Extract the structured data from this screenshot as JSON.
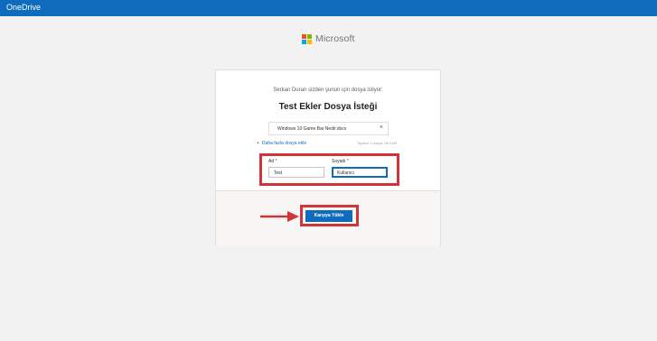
{
  "topbar": {
    "app_name": "OneDrive"
  },
  "brand": {
    "name": "Microsoft",
    "colors": [
      "#f25022",
      "#7fba00",
      "#00a4ef",
      "#ffb900"
    ]
  },
  "request": {
    "subtitle": "Serkan Duran sizden şunun için dosya istiyor:",
    "title": "Test Ekler Dosya İsteği"
  },
  "file": {
    "name": "Windows 10 Game Bar Nedir.docx",
    "remove_icon": "×"
  },
  "add_more": {
    "label": "Daha fazla dosya ekle",
    "icon": "+"
  },
  "total": {
    "text": "Toplam 1 dosya: 38,3 kB"
  },
  "form": {
    "first_name_label": "Ad",
    "first_name_value": "Test",
    "last_name_label": "Soyadı",
    "last_name_value": "Kullanıcı",
    "required_marker": "*"
  },
  "upload": {
    "label": "Karşıya Yükle"
  },
  "colors": {
    "accent": "#0f6cbd",
    "annotation_red": "#d13438"
  }
}
